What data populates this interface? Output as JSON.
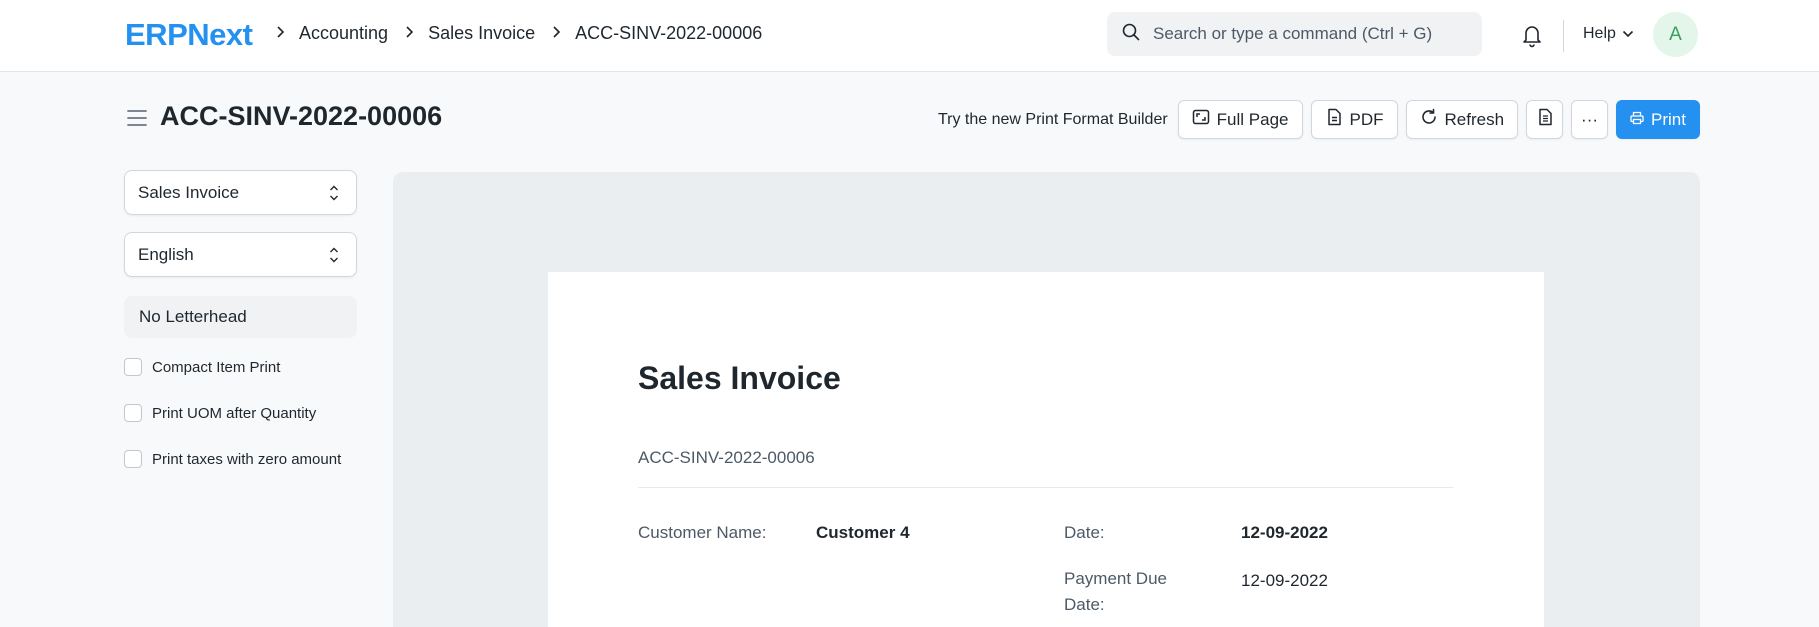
{
  "navbar": {
    "logo": "ERPNext",
    "breadcrumbs": [
      "Accounting",
      "Sales Invoice",
      "ACC-SINV-2022-00006"
    ],
    "search_placeholder": "Search or type a command (Ctrl + G)",
    "help_label": "Help",
    "avatar_initial": "A"
  },
  "page": {
    "title": "ACC-SINV-2022-00006",
    "try_builder_text": "Try the new Print Format Builder",
    "buttons": {
      "full_page": "Full Page",
      "pdf": "PDF",
      "refresh": "Refresh",
      "more": "···",
      "print": "Print"
    }
  },
  "sidebar": {
    "print_format": "Sales Invoice",
    "language": "English",
    "letterhead": "No Letterhead",
    "options": [
      {
        "label": "Compact Item Print",
        "checked": false
      },
      {
        "label": "Print UOM after Quantity",
        "checked": false
      },
      {
        "label": "Print taxes with zero amount",
        "checked": false
      }
    ]
  },
  "document": {
    "title": "Sales Invoice",
    "name": "ACC-SINV-2022-00006",
    "customer_name_label": "Customer Name:",
    "customer_name": "Customer 4",
    "date_label": "Date:",
    "date": "12-09-2022",
    "due_date_label_line1": "Payment Due",
    "due_date_label_line2": "Date:",
    "due_date": "12-09-2022"
  },
  "colors": {
    "primary": "#2490ef",
    "text": "#1f272e",
    "muted": "#4c5a67",
    "avatar_bg": "#e4f5e9",
    "avatar_fg": "#38a160"
  }
}
